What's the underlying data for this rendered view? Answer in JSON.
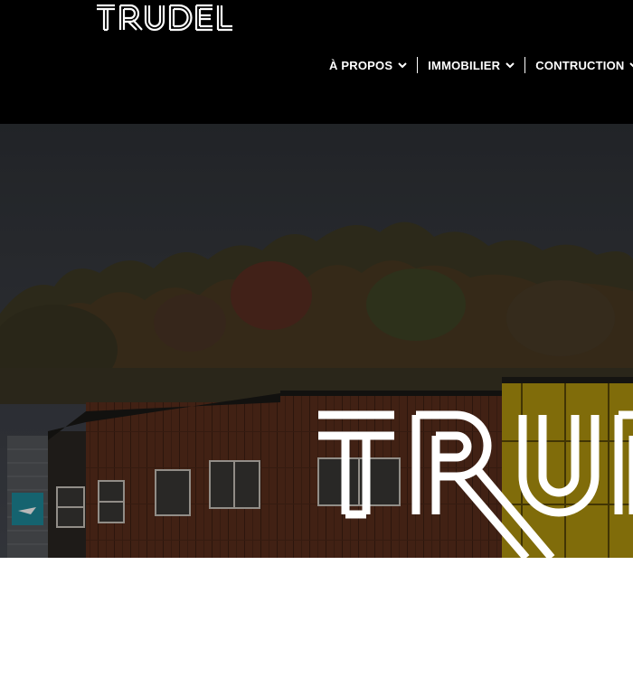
{
  "brand": {
    "logo_text": "TRUDEL",
    "hero_text": "TRUDEL",
    "sign_text": "TRUDEL"
  },
  "nav": {
    "items": [
      {
        "label": "À PROPOS",
        "icon": "chevron-down-icon"
      },
      {
        "label": "IMMOBILIER",
        "icon": "chevron-down-icon"
      },
      {
        "label": "CONTRUCTION",
        "icon": "chevron-down-icon"
      }
    ]
  },
  "colors": {
    "header_bg": "#000000",
    "nav_text": "#ffffff",
    "sky": "#3a3d42",
    "wood": "#5a2e1c",
    "yellow_panel": "#c8a812",
    "sign_teal": "#1e8a9a"
  }
}
